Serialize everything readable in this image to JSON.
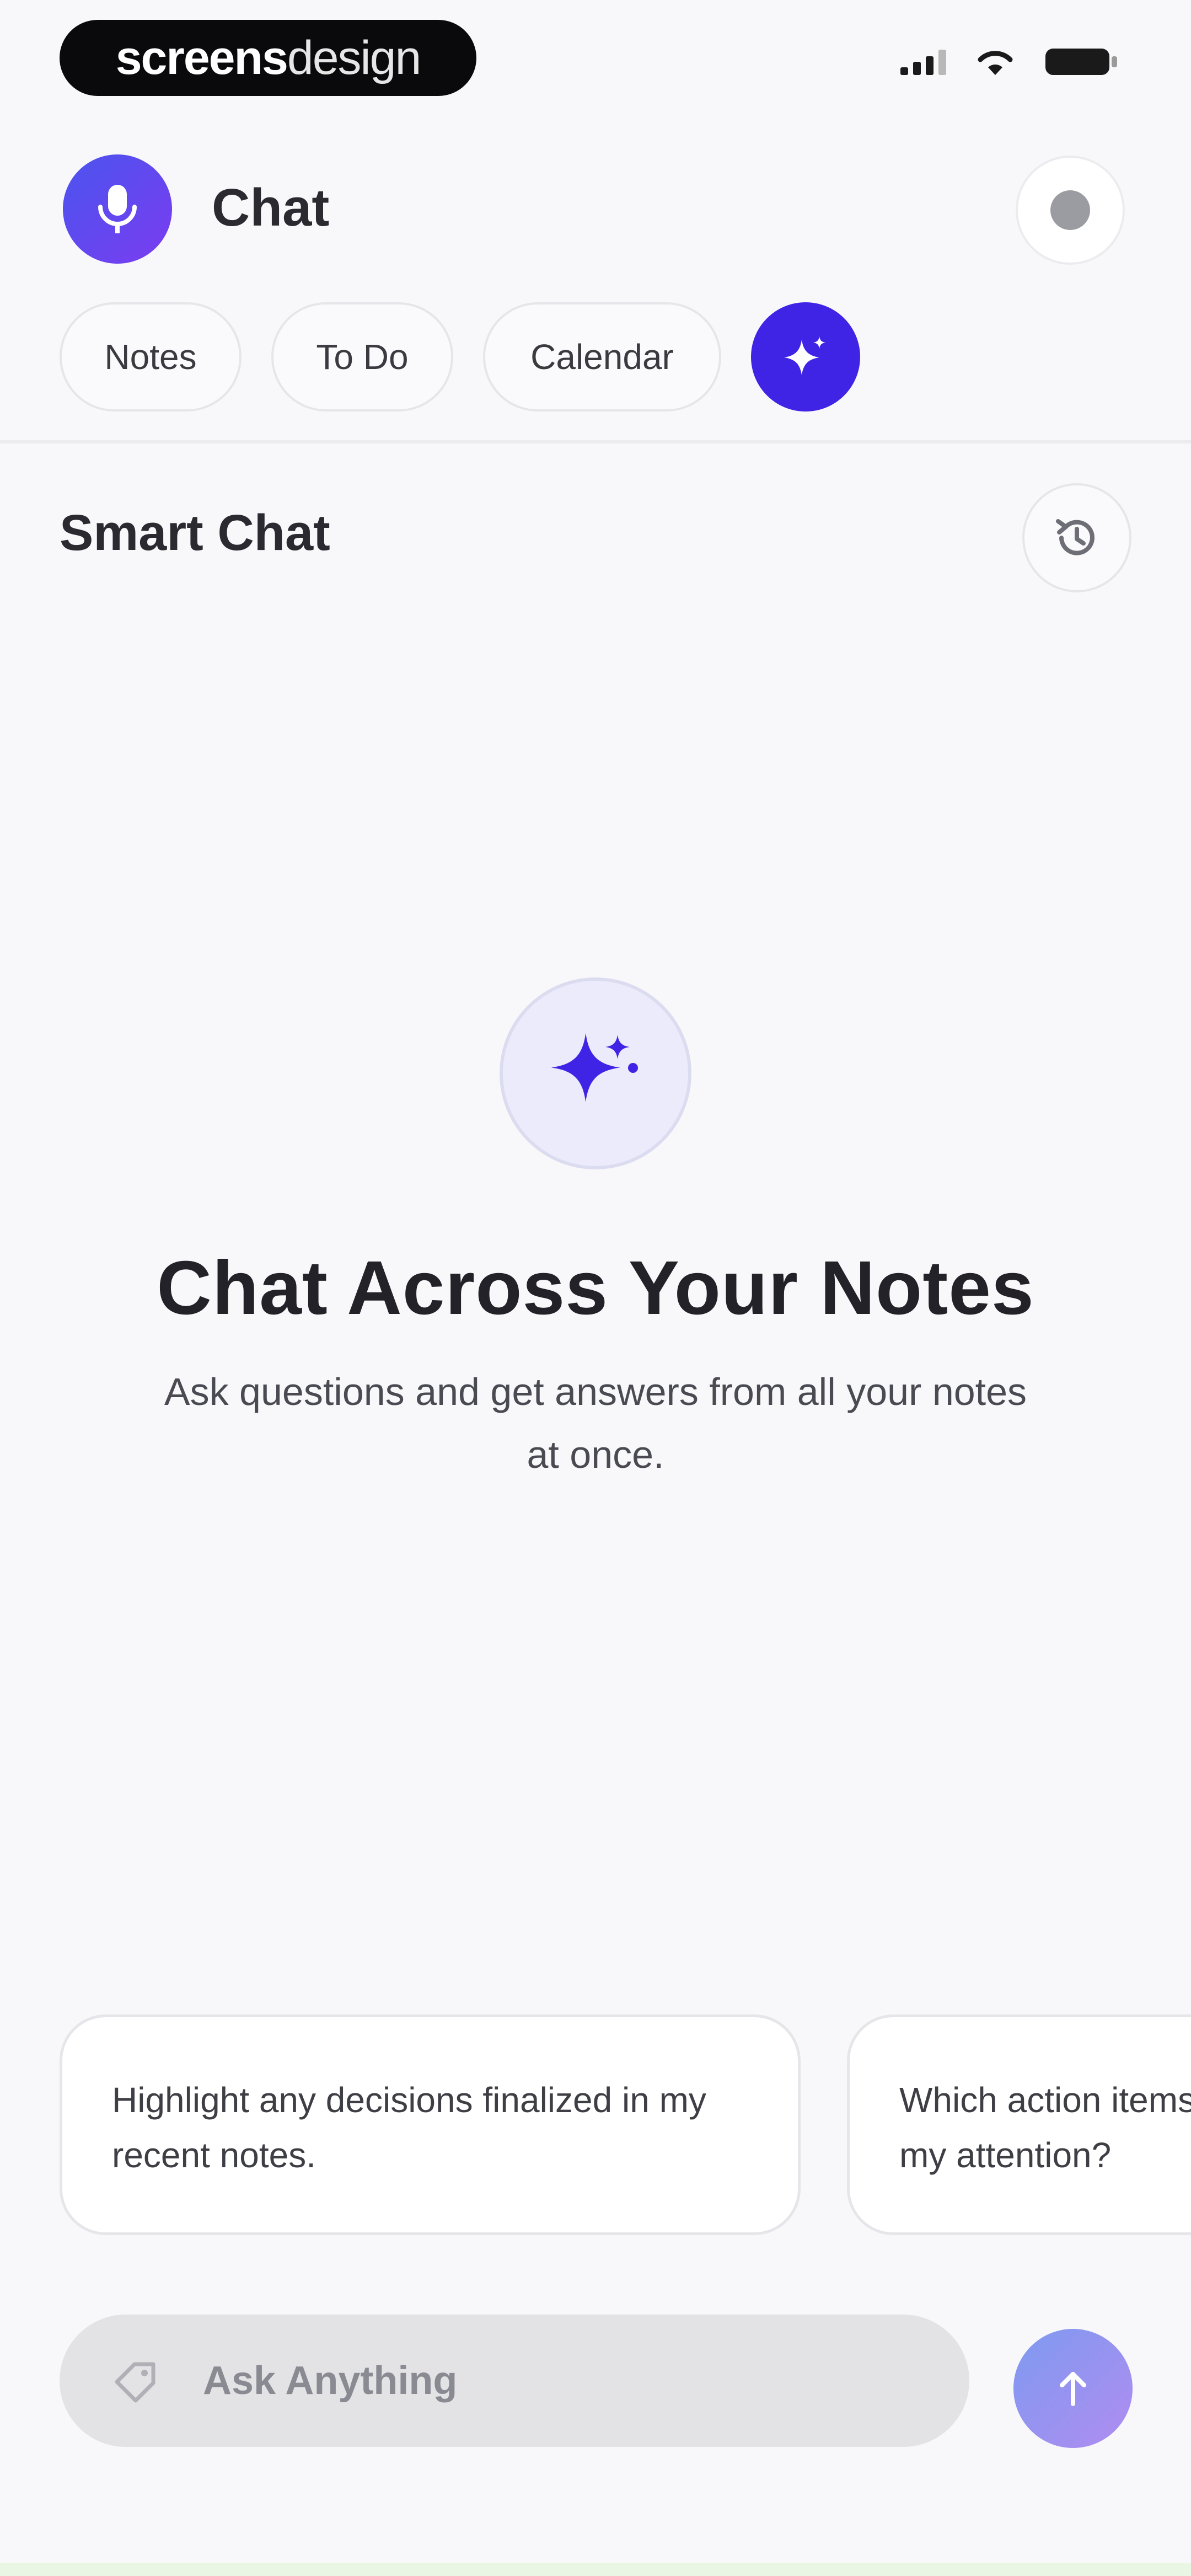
{
  "status_bar": {
    "brand_strong": "screens",
    "brand_light": "design"
  },
  "header": {
    "title": "Chat"
  },
  "tabs": [
    {
      "label": "Notes"
    },
    {
      "label": "To Do"
    },
    {
      "label": "Calendar"
    }
  ],
  "section": {
    "title": "Smart Chat"
  },
  "empty_state": {
    "title": "Chat Across Your Notes",
    "subtitle": "Ask questions and get answers from all your notes at once."
  },
  "suggestions": [
    {
      "text": "Highlight any decisions finalized in my recent notes."
    },
    {
      "text": "Which action items in my notes require my attention?"
    }
  ],
  "input": {
    "placeholder": "Ask Anything",
    "value": ""
  },
  "colors": {
    "accent": "#3f24e6",
    "avatar_gradient_start": "#4a54ee",
    "avatar_gradient_end": "#7b3cf0",
    "send_gradient_start": "#7e9af0",
    "send_gradient_end": "#b08cf0",
    "background": "#f8f8fa"
  },
  "icons": {
    "avatar": "microphone-icon",
    "active_tab": "sparkle-icon",
    "history": "history-icon",
    "empty_state": "sparkles-icon",
    "input": "tag-icon",
    "send": "arrow-up-icon"
  }
}
